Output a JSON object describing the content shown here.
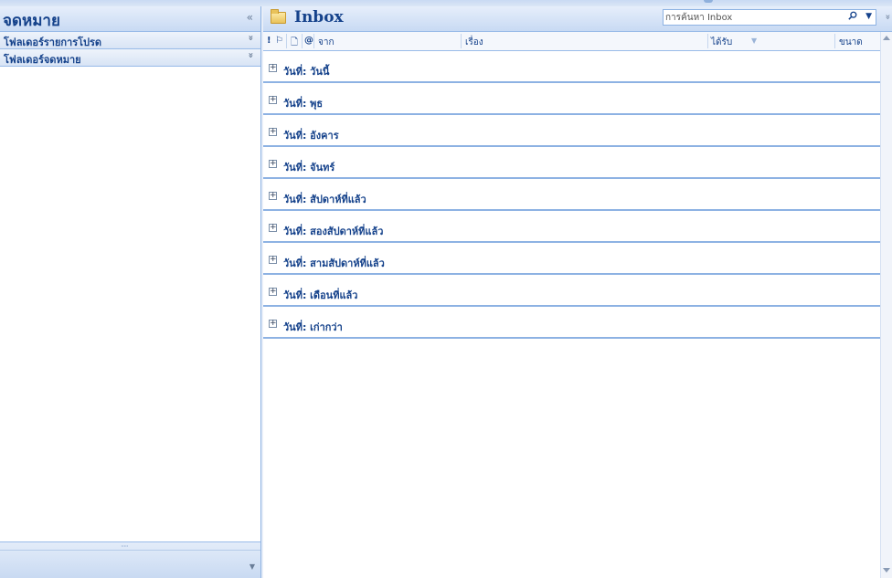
{
  "left_pane": {
    "title": "จดหมาย",
    "collapse_glyph": "«",
    "sections": [
      {
        "label": "โฟลเดอร์รายการโปรด",
        "chevron": "»"
      },
      {
        "label": "โฟลเดอร์จดหมาย",
        "chevron": "»"
      }
    ],
    "grip": "·····"
  },
  "right_pane": {
    "title": "Inbox",
    "search": {
      "placeholder": "การค้นหา Inbox"
    },
    "columns": {
      "importance": "!",
      "flag": "⚐",
      "item_type": "🗋",
      "attachment": "@",
      "from": "จาก",
      "subject": "เรื่อง",
      "received": "ได้รับ",
      "sort_arrow": "▼",
      "size": "ขนาด"
    },
    "groups": [
      "วันที่: วันนี้",
      "วันที่: พุธ",
      "วันที่: อังคาร",
      "วันที่: จันทร์",
      "วันที่: สัปดาห์ที่แล้ว",
      "วันที่: สองสัปดาห์ที่แล้ว",
      "วันที่: สามสัปดาห์ที่แล้ว",
      "วันที่: เดือนที่แล้ว",
      "วันที่: เก่ากว่า"
    ],
    "expand_glyph": "+"
  },
  "colors": {
    "accent": "#15428b",
    "border": "#8db2e3",
    "header_bg": "#c8daf3"
  }
}
